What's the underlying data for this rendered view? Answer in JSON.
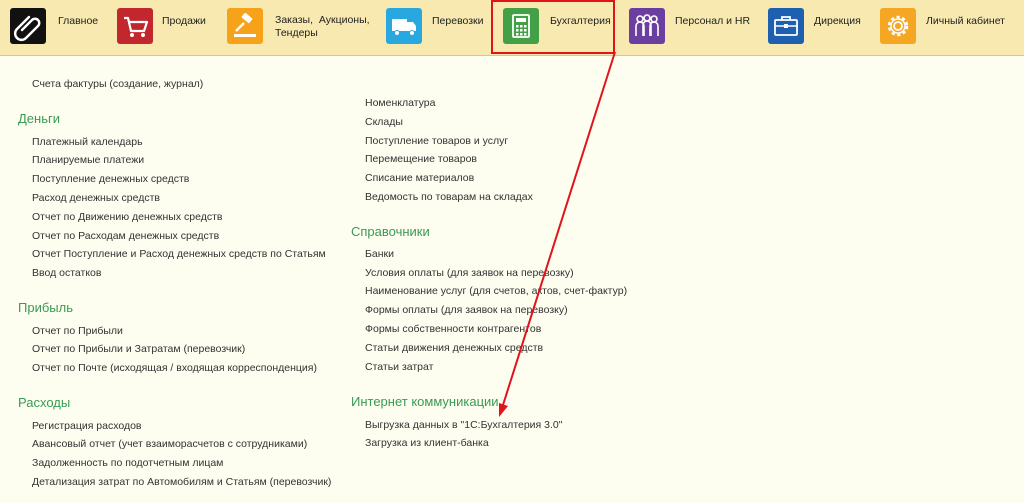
{
  "nav": [
    {
      "label": "Главное"
    },
    {
      "label": "Продажи"
    },
    {
      "label": "Заказы,  Аукционы,\nТендеры"
    },
    {
      "label": "Перевозки"
    },
    {
      "label": "Бухгалтерия"
    },
    {
      "label": "Персонал и HR"
    },
    {
      "label": "Дирекция"
    },
    {
      "label": "Личный кабинет"
    }
  ],
  "colors": {
    "topbar": "#f7e9b0",
    "section_heading": "#3a9a55",
    "highlight": "#e0141a",
    "icons": [
      "#111111",
      "#c1272d",
      "#f7a21b",
      "#29a8e0",
      "#43a047",
      "#6a3fa0",
      "#1f5fb0",
      "#f5a623"
    ]
  },
  "left": {
    "cut_top": "Счета фактуры (создание, журнал)",
    "money": {
      "title": "Деньги",
      "items": [
        "Платежный календарь",
        "Планируемые платежи",
        "Поступление денежных средств",
        "Расход денежных средств",
        "Отчет по Движению денежных средств",
        "Отчет по Расходам денежных средств",
        "Отчет Поступление и Расход денежных средств по Статьям",
        "Ввод остатков"
      ]
    },
    "profit": {
      "title": "Прибыль",
      "items": [
        "Отчет по Прибыли",
        "Отчет по Прибыли и Затратам (перевозчик)",
        "Отчет по Почте (исходящая / входящая корреспонденция)"
      ]
    },
    "expenses": {
      "title": "Расходы",
      "items": [
        "Регистрация расходов",
        "Авансовый отчет (учет взаиморасчетов с сотрудниками)",
        "Задолженность по подотчетным лицам",
        "Детализация затрат по Автомобилям и Статьям (перевозчик)"
      ]
    }
  },
  "right": {
    "goods": {
      "items": [
        "Номенклатура",
        "Склады",
        "Поступление товаров и услуг",
        "Перемещение товаров",
        "Списание материалов",
        "Ведомость по товарам на складах"
      ]
    },
    "refs": {
      "title": "Справочники",
      "items": [
        "Банки",
        "Условия оплаты (для заявок на перевозку)",
        "Наименование услуг (для счетов, актов, счет-фактур)",
        "Формы оплаты (для заявок на перевозку)",
        "Формы собственности контрагентов",
        "Статьи движения денежных средств",
        "Статьи затрат"
      ]
    },
    "internet": {
      "title": "Интернет коммуникации",
      "items": [
        "Выгрузка данных в \"1С:Бухгалтерия 3.0\"",
        "Загрузка из клиент-банка"
      ]
    }
  }
}
